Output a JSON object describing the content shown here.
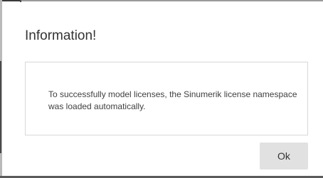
{
  "dialog": {
    "title": "Information!",
    "message": "To successfully model licenses, the Sinumerik license namespace was loaded automatically.",
    "ok_label": "Ok"
  },
  "colors": {
    "button_bg": "#e1e1e1",
    "border": "#d8d8d8",
    "text": "#333333"
  }
}
